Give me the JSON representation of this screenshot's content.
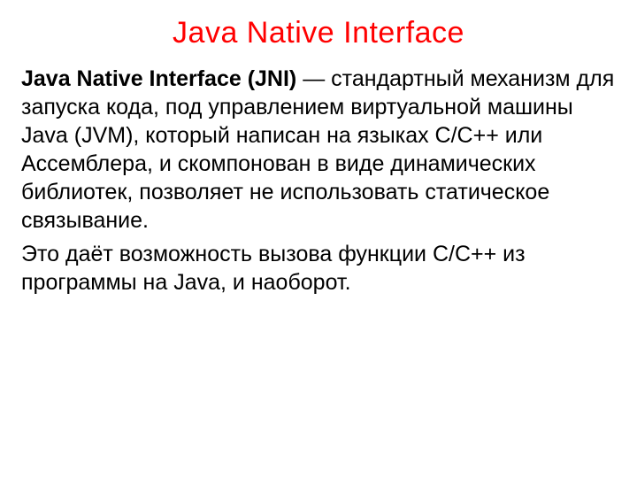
{
  "title": "Java Native Interface",
  "para1_bold": "Java Native Interface (JNI)",
  "para1_rest": " — стандартный механизм для запуска кода, под управлением виртуальной машины Java (JVM), который написан на языках С/C++ или Ассемблера, и скомпонован в виде динамических библиотек, позволяет не использовать статическое связывание.",
  "para2": "Это даёт возможность вызова функции С/C++ из программы на Java, и наоборот."
}
